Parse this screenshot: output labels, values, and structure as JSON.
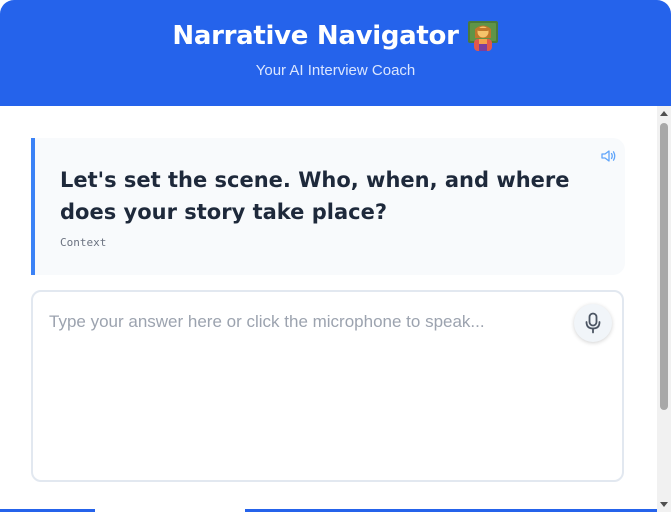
{
  "header": {
    "title": "Narrative Navigator",
    "title_icon": "teacher-emoji-icon",
    "subtitle": "Your AI Interview Coach",
    "background": "#2563eb"
  },
  "question": {
    "text": "Let's set the scene. Who, when, and where does your story take place?",
    "tag": "Context",
    "accent": "#3b82f6",
    "speaker_icon": "speaker-icon"
  },
  "answer": {
    "value": "",
    "placeholder": "Type your answer here or click the microphone to speak...",
    "mic_icon": "microphone-icon"
  }
}
